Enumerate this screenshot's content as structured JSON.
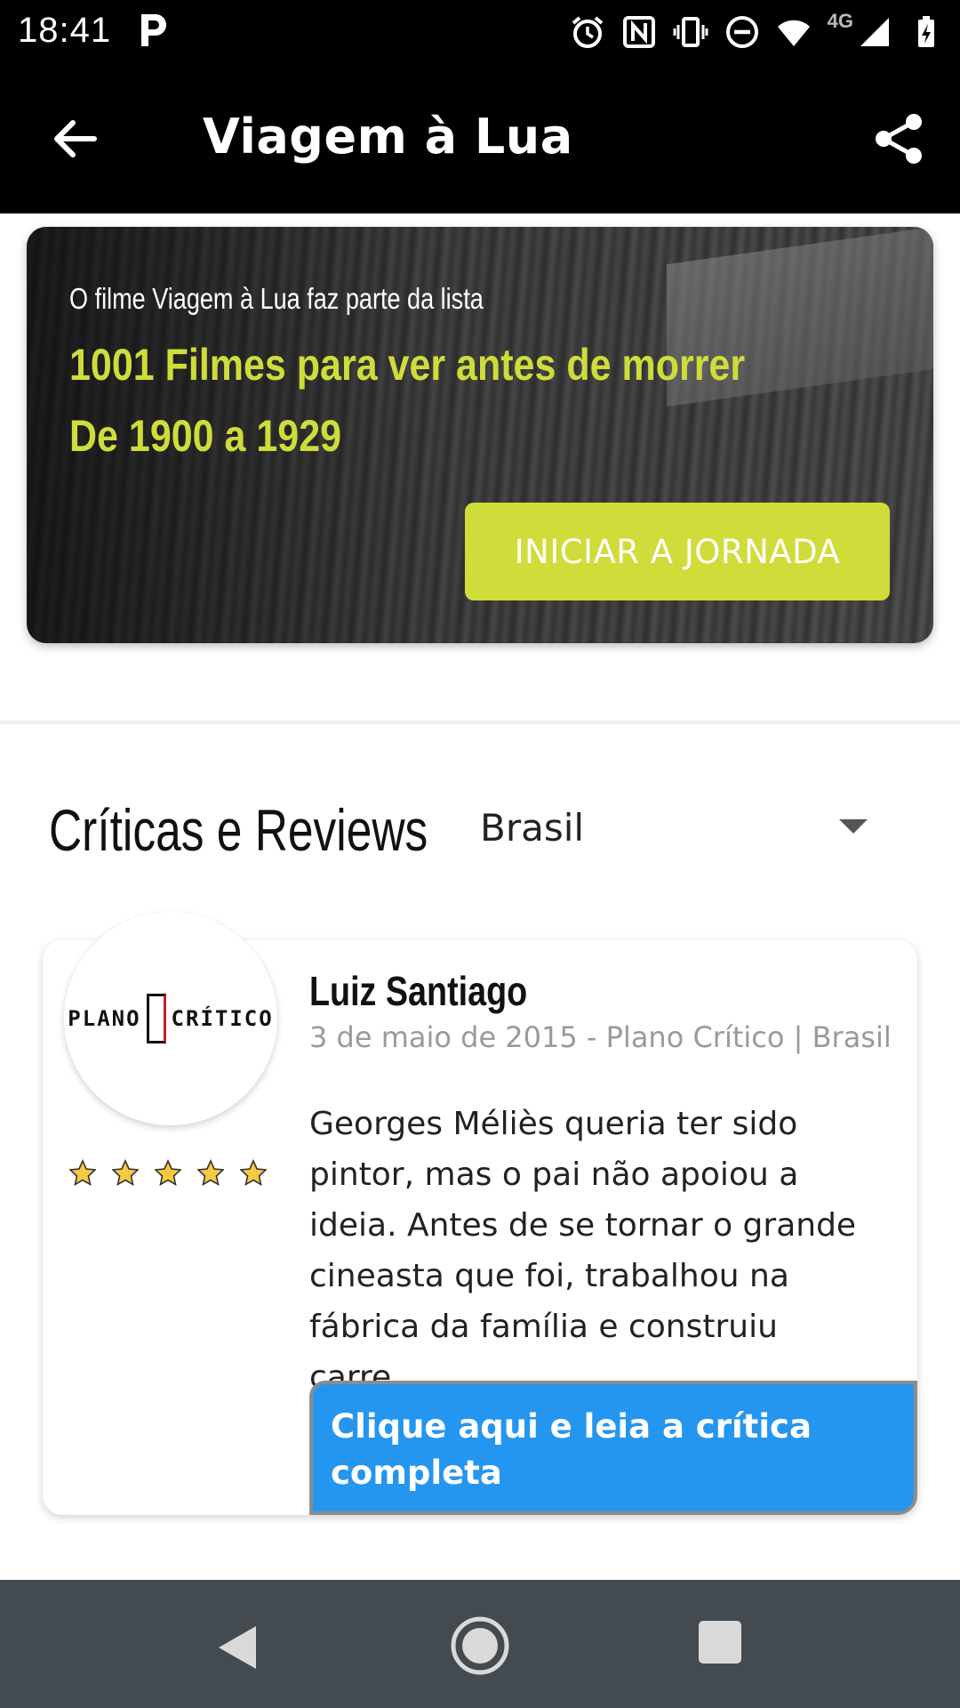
{
  "status_bar": {
    "time": "18:41",
    "network": "4G"
  },
  "app_bar": {
    "title": "Viagem à Lua"
  },
  "banner": {
    "subtitle": "O filme Viagem à Lua faz parte da lista",
    "list_title": "1001 Filmes para ver antes de morrer De 1900 a 1929",
    "button_label": "INICIAR A JORNADA",
    "accent_color": "#cfdc3a"
  },
  "reviews": {
    "title": "Críticas e Reviews",
    "region": "Brasil",
    "items": [
      {
        "reviewer": "Luiz Santiago",
        "meta": "3 de maio de 2015 - Plano Crítico | Brasil",
        "source_logo_left": "PLANO",
        "source_logo_right": "CRÍTICO",
        "rating_stars": 5,
        "excerpt": "Georges Méliès queria ter sido pintor, mas o pai não apoiou a ideia. Antes de se tornar o grande cineasta que foi, trabalhou na fábrica da família e construiu carre...",
        "read_more_label": "Clique aqui e leia a crítica completa",
        "button_color": "#2596ef"
      }
    ]
  }
}
